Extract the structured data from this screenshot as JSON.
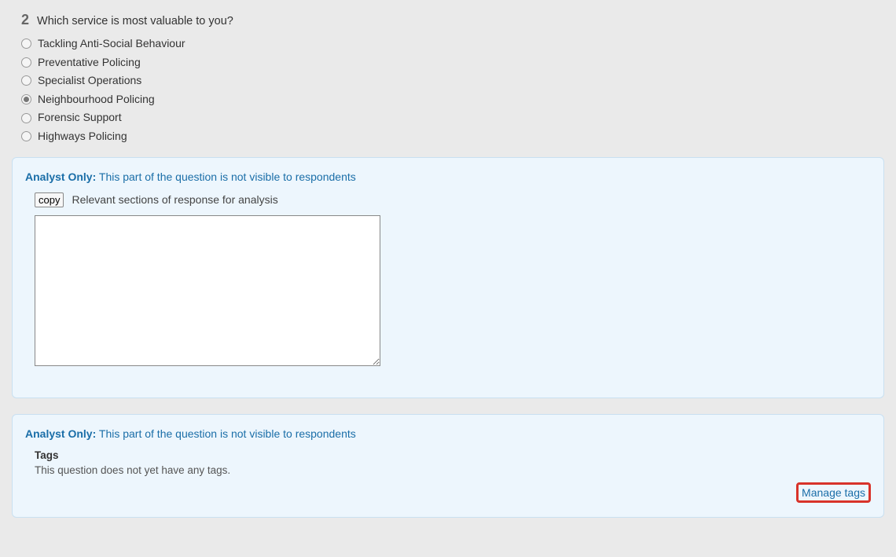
{
  "question": {
    "number": "2",
    "text": "Which service is most valuable to you?",
    "options": [
      {
        "label": "Tackling Anti-Social Behaviour",
        "selected": false
      },
      {
        "label": "Preventative Policing",
        "selected": false
      },
      {
        "label": "Specialist Operations",
        "selected": false
      },
      {
        "label": "Neighbourhood Policing",
        "selected": true
      },
      {
        "label": "Forensic Support",
        "selected": false
      },
      {
        "label": "Highways Policing",
        "selected": false
      }
    ]
  },
  "analyst1": {
    "heading_strong": "Analyst Only:",
    "heading_sub": "This part of the question is not visible to respondents",
    "copy_button": "copy",
    "copy_label": "Relevant sections of response for analysis",
    "textarea_value": ""
  },
  "analyst2": {
    "heading_strong": "Analyst Only:",
    "heading_sub": "This part of the question is not visible to respondents",
    "tags_title": "Tags",
    "tags_empty": "This question does not yet have any tags.",
    "manage_tags": "Manage tags"
  }
}
